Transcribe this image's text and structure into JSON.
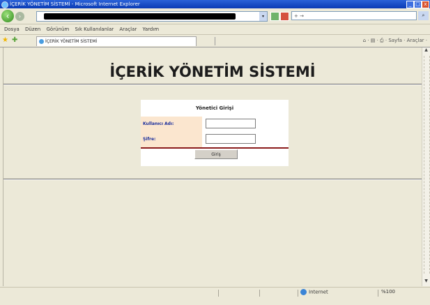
{
  "window": {
    "title": "İÇERİK YÖNETİM SİSTEMİ - Microsoft Internet Explorer",
    "controls": [
      "_",
      "□",
      "x"
    ]
  },
  "toolbar": {
    "address_value": "",
    "search_placeholder": "+ →"
  },
  "menu": [
    "Dosya",
    "Düzen",
    "Görünüm",
    "Sık Kullanılanlar",
    "Araçlar",
    "Yardım"
  ],
  "tab": {
    "label": "İÇERİK YÖNETİM SİSTEMİ",
    "tools_text": "⌂ · ▤ · ⎙ · Sayfa · Araçlar ·"
  },
  "page": {
    "heading": "İÇERİK YÖNETİM SİSTEMİ",
    "login": {
      "title": "Yönetici Girişi",
      "username_label": "Kullanıcı Adı:",
      "password_label": "Şifre:",
      "username_value": "",
      "password_value": "",
      "submit_label": "Giriş"
    }
  },
  "status": {
    "zone": "Internet",
    "zoom": "%100"
  },
  "colors": {
    "title_bar": "#0a3bb4",
    "label_bg": "#fbe6cf",
    "label_text": "#1b2e9c",
    "divider_red": "#8b1c1c"
  }
}
